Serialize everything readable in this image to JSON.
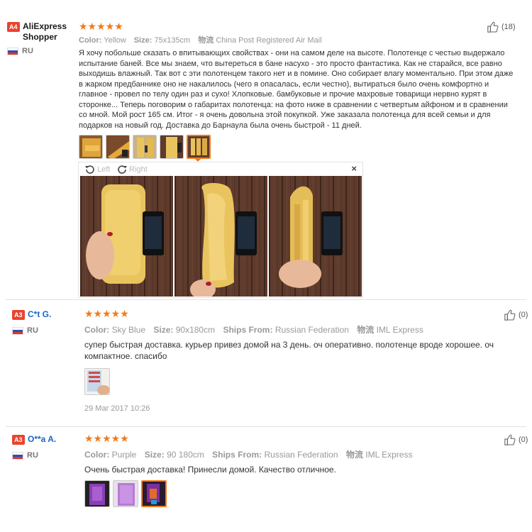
{
  "reviews": [
    {
      "level": "A4",
      "user": "AliExpress Shopper",
      "country": "RU",
      "stars": "★★★★★",
      "color_label": "Color:",
      "color": "Yellow",
      "size_label": "Size:",
      "size": "75x135cm",
      "ship_label": "物流",
      "ship": "China Post Registered Air Mail",
      "helpful": "(18)",
      "text": "Я хочу побольше сказать о впитывающих свойствах - они на самом деле на высоте. Полотенце с честью выдержало испытание баней. Все мы знаем, что вытереться в бане насухо - это просто фантастика. Как не старайся, все равно выходишь влажный. Так вот с эти полотенцем такого нет и в помине. Оно собирает влагу моментально. При этом даже в жарком предбаннике оно не накалилось (чего я опасалась, если честно), вытираться было очень комфортно и главное - провел по телу один раз и сухо! Хлопковые. бамбуковые и прочие махровые товарищи нервно курят в сторонке... Теперь поговорим о габаритах полотенца: на фото ниже в сравнении с четвертым айфоном и в сравнении со мной. Мой рост 165 см. Итог - я очень довольна этой покупкой. Уже заказала полотенца для всей семьи и для подарков на новый год. Доставка до Барнаула была очень быстрой - 11 дней.",
      "viewer": {
        "left": "Left",
        "right": "Right",
        "close": "×"
      }
    },
    {
      "level": "A3",
      "user": "C*t G.",
      "country": "RU",
      "stars": "★★★★★",
      "color_label": "Color:",
      "color": "Sky Blue",
      "size_label": "Size:",
      "size": "90x180cm",
      "ships_from_label": "Ships From:",
      "ships_from": "Russian Federation",
      "ship_label": "物流",
      "ship": "IML Express",
      "helpful": "(0)",
      "text": "супер быстрая доставка. курьер привез домой на 3 день. оч оперативно. полотенце вроде хорошее. оч компактное. спасибо",
      "date": "29 Mar 2017 10:26"
    },
    {
      "level": "A3",
      "user": "O**a A.",
      "country": "RU",
      "stars": "★★★★★",
      "color_label": "Color:",
      "color": "Purple",
      "size_label": "Size:",
      "size": "90 180cm",
      "ships_from_label": "Ships From:",
      "ships_from": "Russian Federation",
      "ship_label": "物流",
      "ship": "IML Express",
      "helpful": "(0)",
      "text": "Очень быстрая доставка! Принесли домой. Качество отличное."
    }
  ],
  "colors": {
    "star": "#f27a1a",
    "badge": "#e8442e",
    "username_blue": "#1a64c7",
    "towel_yellow": "#e9c45e",
    "wood": "#5a3a2e"
  },
  "icons": [
    "thumbs-up-icon",
    "rotate-left-icon",
    "rotate-right-icon",
    "close-icon",
    "flag-ru-icon"
  ]
}
